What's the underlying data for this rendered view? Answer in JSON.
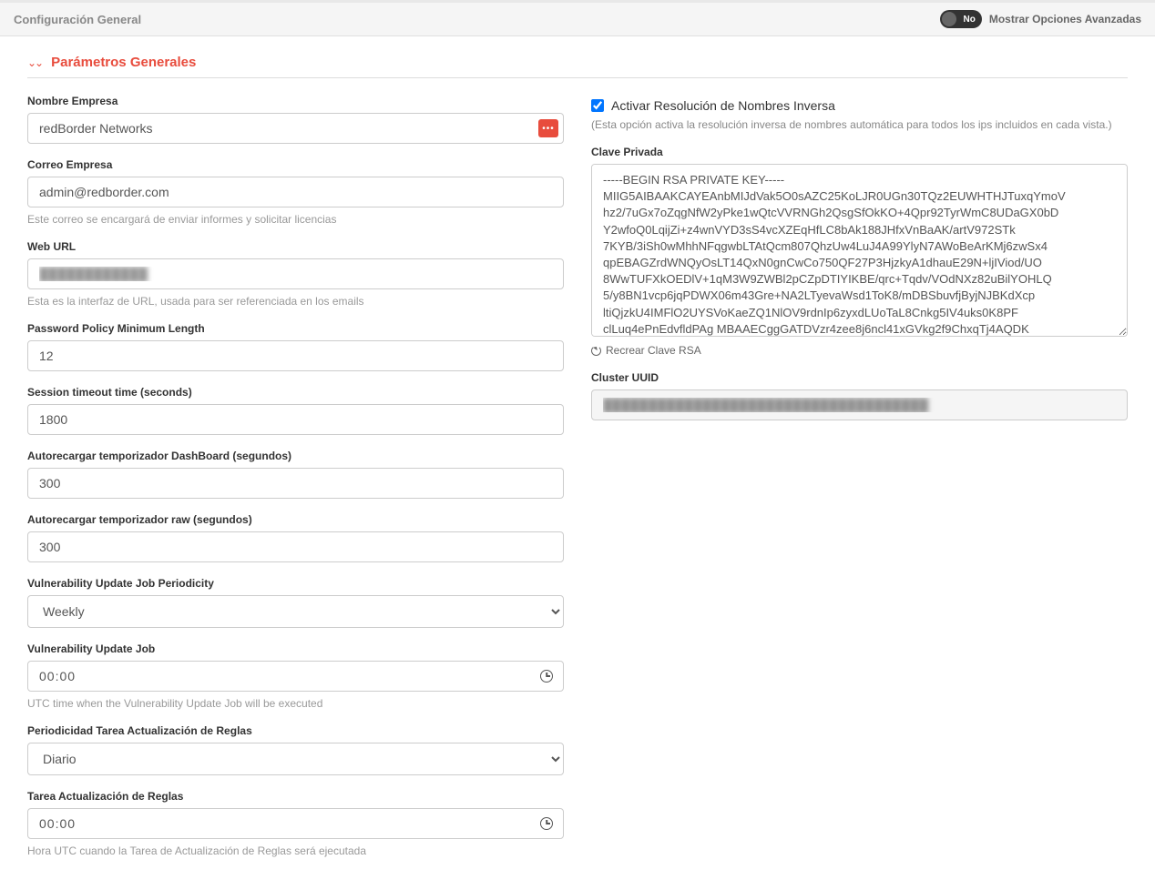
{
  "topbar": {
    "title": "Configuración General",
    "advanced_label": "Mostrar Opciones Avanzadas",
    "toggle_state": "No"
  },
  "section": {
    "title": "Parámetros Generales"
  },
  "left": {
    "company_name": {
      "label": "Nombre Empresa",
      "value": "redBorder Networks"
    },
    "company_email": {
      "label": "Correo Empresa",
      "value": "admin@redborder.com",
      "help": "Este correo se encargará de enviar informes y solicitar licencias"
    },
    "web_url": {
      "label": "Web URL",
      "value": "",
      "placeholder_masked": "████████████",
      "help": "Esta es la interfaz de URL, usada para ser referenciada en los emails"
    },
    "pwd_min_len": {
      "label": "Password Policy Minimum Length",
      "value": "12"
    },
    "session_timeout": {
      "label": "Session timeout time (seconds)",
      "value": "1800"
    },
    "dash_reload": {
      "label": "Autorecargar temporizador DashBoard (segundos)",
      "value": "300"
    },
    "raw_reload": {
      "label": "Autorecargar temporizador raw (segundos)",
      "value": "300"
    },
    "vuln_period": {
      "label": "Vulnerability Update Job Periodicity",
      "value": "Weekly",
      "options": [
        "Weekly"
      ]
    },
    "vuln_job": {
      "label": "Vulnerability Update Job",
      "value": "00:00",
      "help": "UTC time when the Vulnerability Update Job will be executed"
    },
    "rules_period": {
      "label": "Periodicidad Tarea Actualización de Reglas",
      "value": "Diario",
      "options": [
        "Diario"
      ]
    },
    "rules_job": {
      "label": "Tarea Actualización de Reglas",
      "value": "00:00",
      "help": "Hora UTC cuando la Tarea de Actualización de Reglas será ejecutada"
    }
  },
  "right": {
    "reverse_dns": {
      "label": "Activar Resolución de Nombres Inversa",
      "checked": true,
      "help": "(Esta opción activa la resolución inversa de nombres automática para todos los ips incluidos en cada vista.)"
    },
    "private_key": {
      "label": "Clave Privada",
      "value": "-----BEGIN RSA PRIVATE KEY-----\nMIIG5AIBAAKCAYEAnbMIJdVak5O0sAZC25KoLJR0UGn30TQz2EUWHTHJTuxqYmoV\nhz2/7uGx7oZqgNfW2yPke1wQtcVVRNGh2QsgSfOkKO+4Qpr92TyrWmC8UDaGX0bD\nY2wfoQ0LqijZi+z4wnVYD3sS4vcXZEqHfLC8bAk188JHfxVnBaAK/artV972STk\n7KYB/3iSh0wMhhNFqgwbLTAtQcm807QhzUw4LuJ4A99YlyN7AWoBeArKMj6zwSx4\nqpEBAGZrdWNQyOsLT14QxN0gnCwCo750QF27P3HjzkyA1dhauE29N+ljIViod/UO\n8WwTUFXkOEDlV+1qM3W9ZWBl2pCZpDTIYIKBE/qrc+Tqdv/VOdNXz82uBilYOHLQ\n5/y8BN1vcp6jqPDWX06m43Gre+NA2LTyevaWsd1ToK8/mDBSbuvfjByjNJBKdXcp\nltiQjzkU4IMFlO2UYSVoKaeZQ1NlOV9rdnIp6zyxdLUoTaL8Cnkg5IV4uks0K8PF\nclLuq4ePnEdvfldPAg MBAAECggGATDVzr4zee8j6ncl41xGVkg2f9ChxqTj4AQDK\n"
    },
    "regen_rsa": "Recrear Clave RSA",
    "cluster_uuid": {
      "label": "Cluster UUID",
      "value_masked": "████████████████████████████████████"
    }
  }
}
